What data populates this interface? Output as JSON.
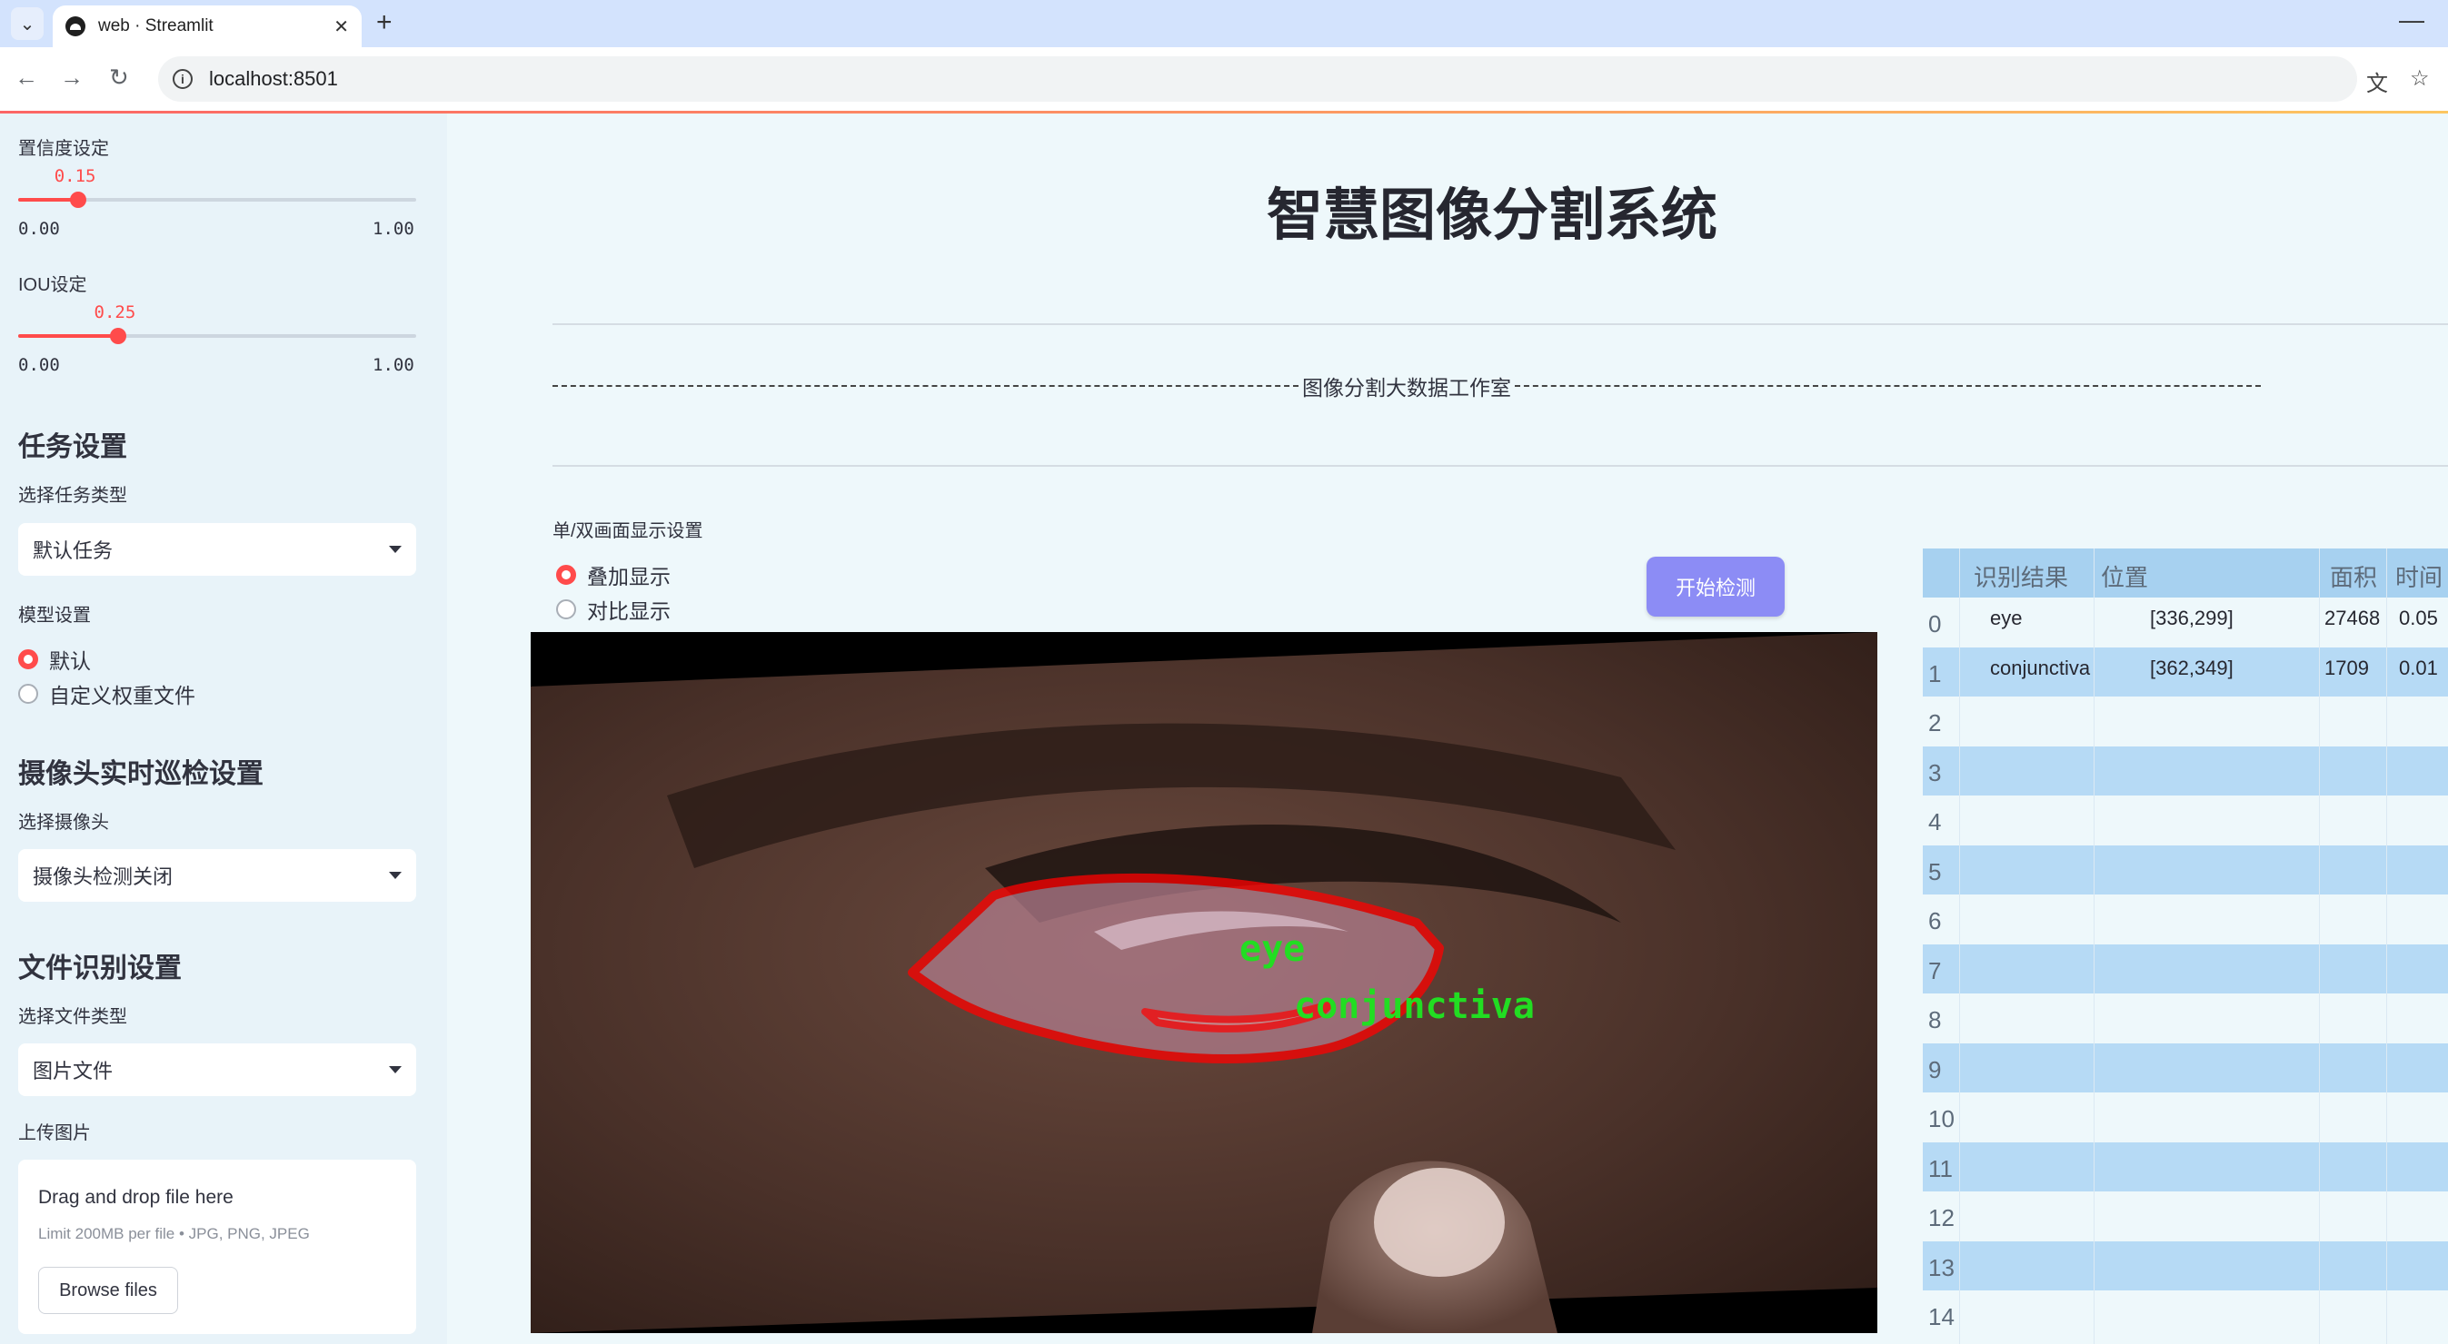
{
  "browser": {
    "tab_title": "web · Streamlit",
    "url": "localhost:8501"
  },
  "sidebar": {
    "confidence": {
      "label": "置信度设定",
      "value": "0.15",
      "value_num": 0.15,
      "min": "0.00",
      "max": "1.00"
    },
    "iou": {
      "label": "IOU设定",
      "value": "0.25",
      "value_num": 0.25,
      "min": "0.00",
      "max": "1.00"
    },
    "task_heading": "任务设置",
    "task_type_label": "选择任务类型",
    "task_type_value": "默认任务",
    "model_label": "模型设置",
    "model_options": [
      "默认",
      "自定义权重文件"
    ],
    "model_selected": "默认",
    "camera_heading": "摄像头实时巡检设置",
    "camera_label": "选择摄像头",
    "camera_value": "摄像头检测关闭",
    "file_heading": "文件识别设置",
    "file_type_label": "选择文件类型",
    "file_type_value": "图片文件",
    "upload_label": "上传图片",
    "upload": {
      "drop_text": "Drag and drop file here",
      "limit_text": "Limit 200MB per file • JPG, PNG, JPEG",
      "browse_label": "Browse files"
    }
  },
  "main": {
    "title": "智慧图像分割系统",
    "studio_text": "图像分割大数据工作室",
    "display_mode_label": "单/双画面显示设置",
    "display_options": [
      "叠加显示",
      "对比显示"
    ],
    "display_selected": "叠加显示",
    "start_button": "开始检测",
    "image_labels": {
      "eye": "eye",
      "conjunctiva": "conjunctiva"
    }
  },
  "results_table": {
    "headers": [
      "识别结果",
      "位置",
      "面积",
      "时间"
    ],
    "rows": [
      {
        "index": "0",
        "result": "eye",
        "position": "[336,299]",
        "area": "27468",
        "time": "0.05"
      },
      {
        "index": "1",
        "result": "conjunctiva",
        "position": "[362,349]",
        "area": "1709",
        "time": "0.01"
      },
      {
        "index": "2"
      },
      {
        "index": "3"
      },
      {
        "index": "4"
      },
      {
        "index": "5"
      },
      {
        "index": "6"
      },
      {
        "index": "7"
      },
      {
        "index": "8"
      },
      {
        "index": "9"
      },
      {
        "index": "10"
      },
      {
        "index": "11"
      },
      {
        "index": "12"
      },
      {
        "index": "13"
      },
      {
        "index": "14"
      }
    ]
  },
  "colors": {
    "accent": "#ff4b4b",
    "button": "#8c8cf5",
    "mask_outline": "#ff0000",
    "label_green": "#22dd22"
  }
}
